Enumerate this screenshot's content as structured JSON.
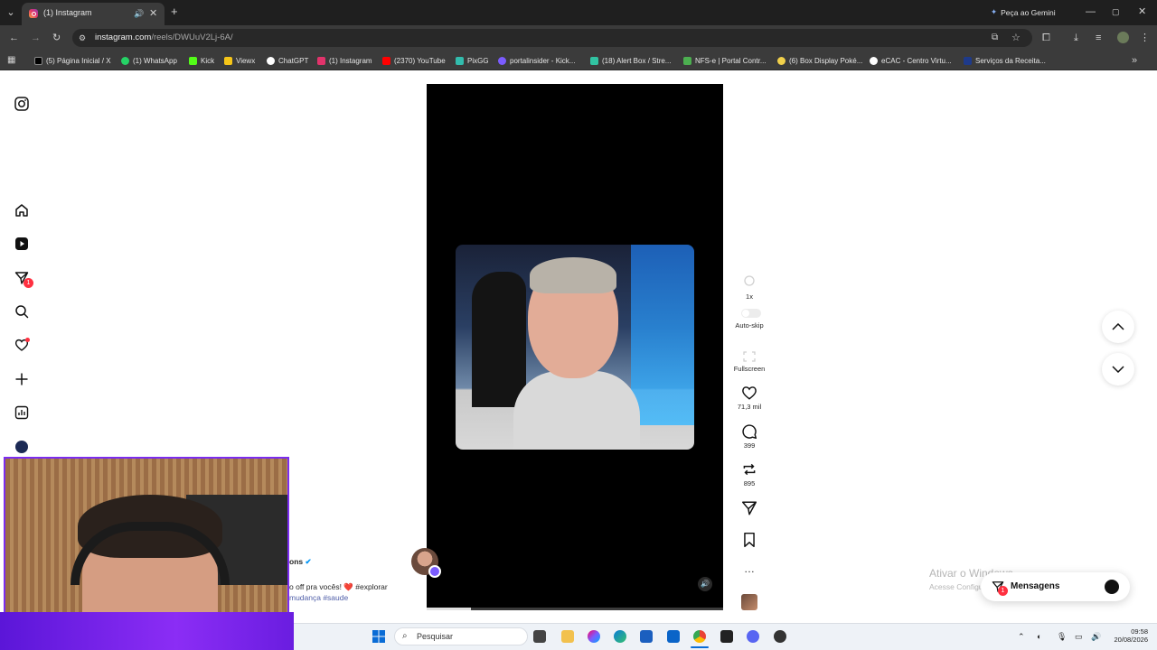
{
  "browser": {
    "tab_title": "(1) Instagram",
    "url_host": "instagram.com",
    "url_path": "/reels/DWUuV2Lj-6A/",
    "gemini_label": "Peça ao Gemini",
    "bookmarks": [
      {
        "label": "(5) Página Inicial / X",
        "color": "#000000"
      },
      {
        "label": "(1) WhatsApp",
        "color": "#25d366"
      },
      {
        "label": "Kick",
        "color": "#53fc18"
      },
      {
        "label": "Viewx",
        "color": "#f5c518"
      },
      {
        "label": "ChatGPT",
        "color": "#ffffff"
      },
      {
        "label": "(1) Instagram",
        "color": "#e2336b"
      },
      {
        "label": "(2370) YouTube",
        "color": "#ff0000"
      },
      {
        "label": "PixGG",
        "color": "#32bcad"
      },
      {
        "label": "portalinsider - Kick...",
        "color": "#7b5cff"
      },
      {
        "label": "(18) Alert Box / Stre...",
        "color": "#31c3a2"
      },
      {
        "label": "NFS-e | Portal Contr...",
        "color": "#4caf50"
      },
      {
        "label": "(6) Box Display Poké...",
        "color": "#f2d14b"
      },
      {
        "label": "eCAC - Centro Virtu...",
        "color": "#ffffff"
      },
      {
        "label": "Serviços da Receita...",
        "color": "#1e3a8a"
      }
    ]
  },
  "reel": {
    "speed_label": "1x",
    "autoskip_label": "Auto-skip",
    "fullscreen_label": "Fullscreen",
    "likes": "71,3 mil",
    "comments": "399",
    "reposts": "895",
    "author_suffix": "ons",
    "caption_line1": "o off pra vocês! ❤️ #explorar",
    "caption_line2": "mudança #saude"
  },
  "messages": {
    "label": "Mensagens",
    "badge": "1"
  },
  "sidebar": {
    "messages_badge": "1"
  },
  "watermark": {
    "line1": "Ativar o Windows",
    "line2": "Acesse Configurações para ativar o Windows."
  },
  "taskbar": {
    "search_placeholder": "Pesquisar",
    "time": "09:58",
    "date": "20/08/2026"
  }
}
